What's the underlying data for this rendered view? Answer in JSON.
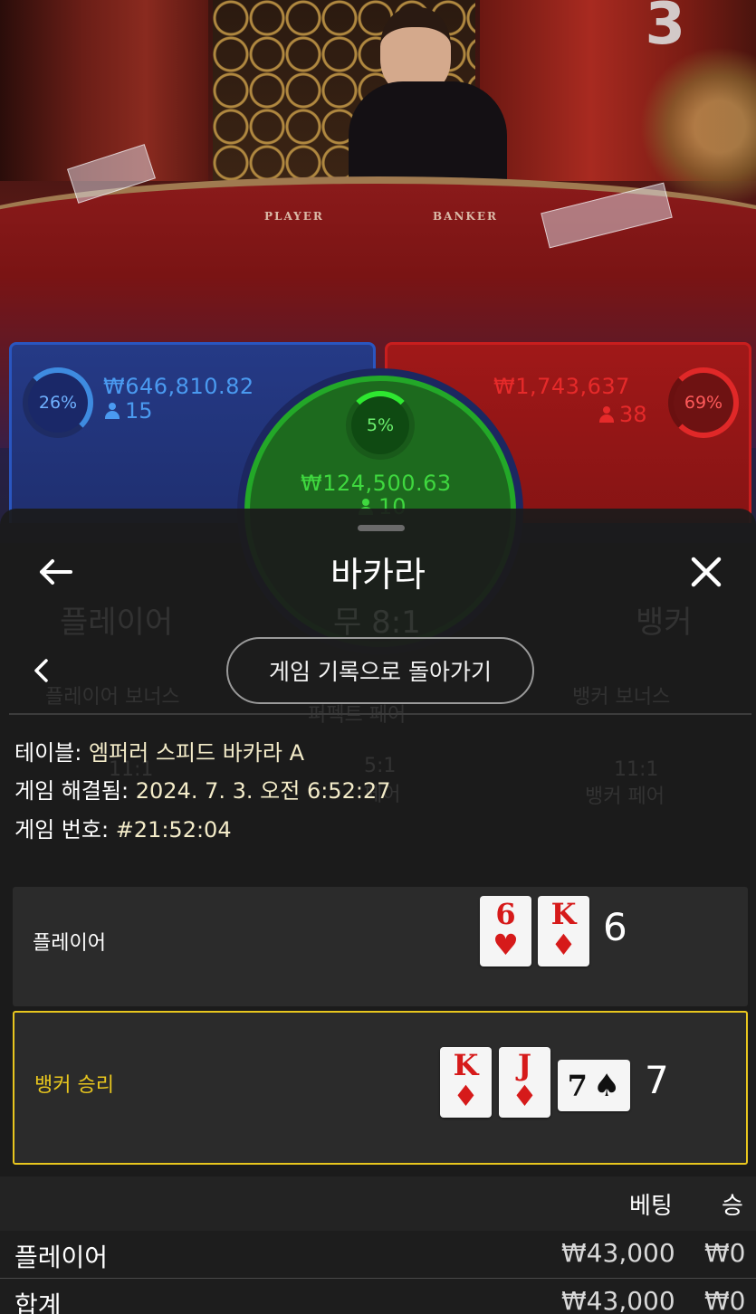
{
  "video": {
    "round_number": "3",
    "table_label_player": "PLAYER",
    "table_label_banker": "BANKER"
  },
  "bets": {
    "player": {
      "percent": "26%",
      "amount": "₩646,810.82",
      "players": "15",
      "color": "#3e8be0"
    },
    "tie": {
      "percent": "5%",
      "amount": "₩124,500.63",
      "players": "10",
      "color": "#2ee830"
    },
    "banker": {
      "percent": "69%",
      "amount": "₩1,743,637",
      "players": "38",
      "color": "#e02828"
    }
  },
  "background_grid": {
    "player": "플레이어",
    "tie": "무 8:1",
    "banker": "뱅커",
    "player_bonus": "플레이어 보너스",
    "perfect_pair": "퍼펙트 페어",
    "banker_bonus": "뱅커 보너스",
    "player_pair_odds": "11:1",
    "either_pair_odds": "5:1",
    "banker_pair_odds": "11:1",
    "banker_pair": "뱅커 페어",
    "either_pair": "페어"
  },
  "sheet": {
    "title": "바카라",
    "back_icon": "arrow-left-icon",
    "close_icon": "close-icon",
    "prev_icon": "chevron-left-icon",
    "history_button": "게임 기록으로 돌아가기",
    "table_label": "테이블:",
    "table_value": "엠퍼러 스피드 바카라 A",
    "resolved_label": "게임 해결됨:",
    "resolved_value": "2024. 7. 3. 오전 6:52:27",
    "game_no_label": "게임 번호:",
    "game_no_value": "#21:52:04",
    "winner_color": "#e8c61e"
  },
  "results": {
    "player": {
      "label": "플레이어",
      "score": "6",
      "cards": [
        {
          "rank": "6",
          "suit": "♥"
        },
        {
          "rank": "K",
          "suit": "♦"
        }
      ]
    },
    "banker": {
      "label": "뱅커 승리",
      "score": "7",
      "cards": [
        {
          "rank": "K",
          "suit": "♦"
        },
        {
          "rank": "J",
          "suit": "♦"
        }
      ],
      "third_card": {
        "rank": "7",
        "suit": "♠"
      }
    }
  },
  "bet_table": {
    "headers": {
      "bet": "베팅",
      "win": "승"
    },
    "rows": [
      {
        "name": "플레이어",
        "bet": "₩43,000",
        "win": "₩0"
      },
      {
        "name": "합계",
        "bet": "₩43,000",
        "win": "₩0"
      }
    ]
  }
}
